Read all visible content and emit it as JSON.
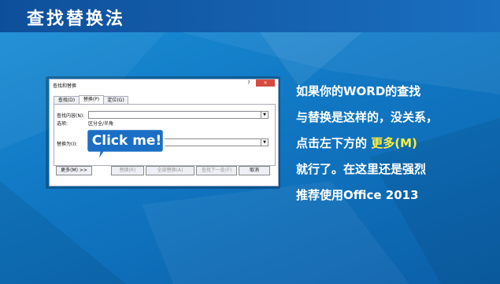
{
  "slide": {
    "title": "查找替换法",
    "colors": {
      "background": "#1178c4",
      "titlebar": "#0e4f9a",
      "highlight": "#ffef3a",
      "callout": "#1a6ec4"
    }
  },
  "dialog": {
    "title": "查找和替换",
    "help_glyph": "?",
    "close_glyph": "×",
    "tabs": [
      {
        "label": "查找(D)"
      },
      {
        "label": "替换(P)"
      },
      {
        "label": "定位(G)"
      }
    ],
    "find_label": "查找内容(N):",
    "options_label": "选项:",
    "options_value": "区分全/半角",
    "replace_label": "替换为(I):",
    "buttons": {
      "more": "更多(M) >>",
      "replace": "替换(R)",
      "replace_all": "全部替换(A)",
      "find_next": "查找下一处(F)",
      "cancel": "取消"
    }
  },
  "callout": {
    "text": "Click me!"
  },
  "note": {
    "line1": "如果你的WORD的查找",
    "line2": "与替换是这样的，没关系，",
    "line3_prefix": "点击左下方的 ",
    "line3_highlight": "更多(M)",
    "line4": "就行了。在这里还是强烈",
    "line5": "推荐使用Office 2013"
  }
}
